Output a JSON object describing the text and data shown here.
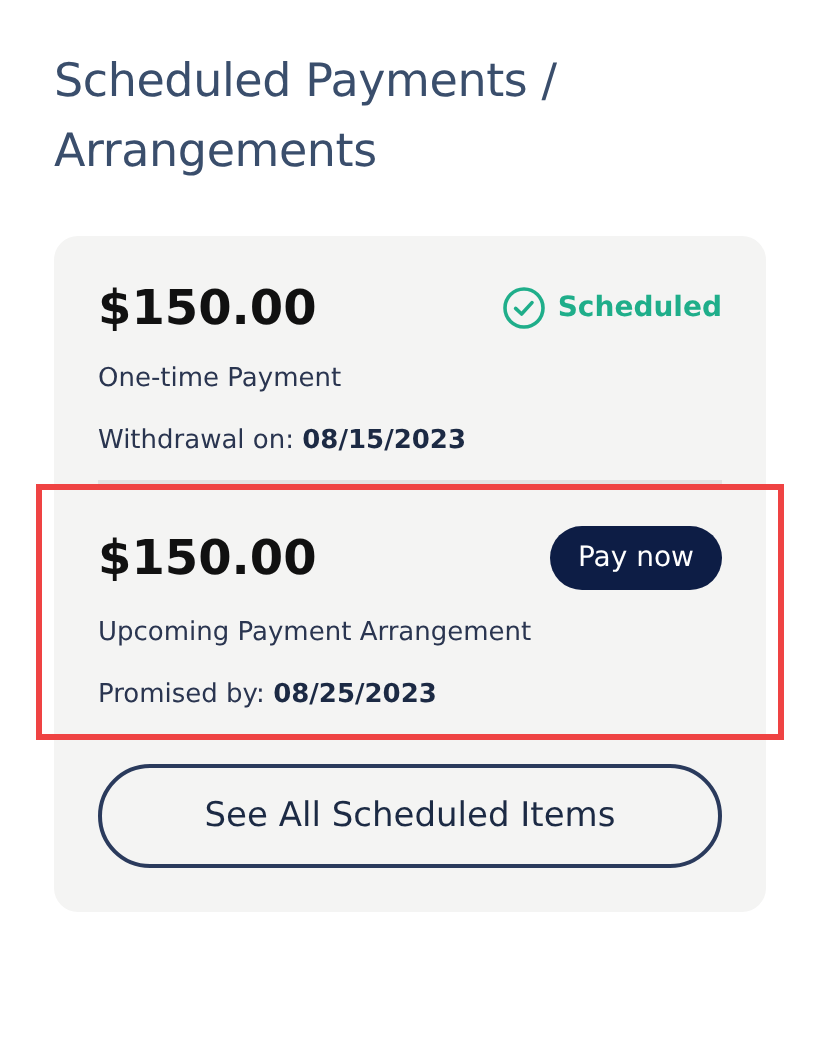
{
  "title": "Scheduled Payments / Arrangements",
  "payments": [
    {
      "amount": "$150.00",
      "kind": "status",
      "status": "Scheduled",
      "type": "One-time Payment",
      "detail": "Withdrawal on: **08/15/2023**",
      "highlighted": false
    },
    {
      "amount": "$150.00",
      "kind": "action",
      "action": "Pay now",
      "type": "Upcoming Payment Arrangement",
      "detail": "Promised by: **08/25/2023**",
      "highlighted": true
    }
  ],
  "see_all_button": "See All Scheduled Items"
}
